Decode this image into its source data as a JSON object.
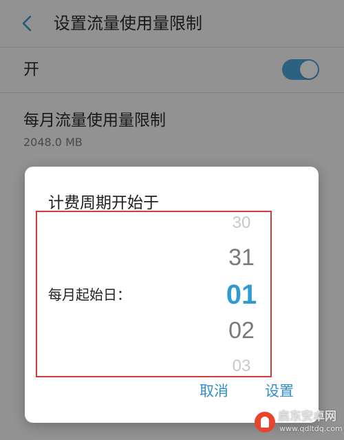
{
  "header": {
    "title": "设置流量使用量限制"
  },
  "toggle_row": {
    "label": "开",
    "state": "on"
  },
  "limit_row": {
    "label": "每月流量使用量限制",
    "value": "2048.0 MB"
  },
  "dialog": {
    "title": "计费周期开始于",
    "picker_label": "每月起始日：",
    "wheel": {
      "faint_above": "30",
      "above": "31",
      "selected": "01",
      "below": "02",
      "faint_below": "03"
    },
    "cancel_label": "取消",
    "confirm_label": "设置"
  },
  "watermark": {
    "name": "启东安卓网",
    "url": "www.qdltdq.com"
  },
  "colors": {
    "accent": "#2f9bd0",
    "toggle": "#4aa4d8",
    "highlight_box": "#d33b3b"
  }
}
